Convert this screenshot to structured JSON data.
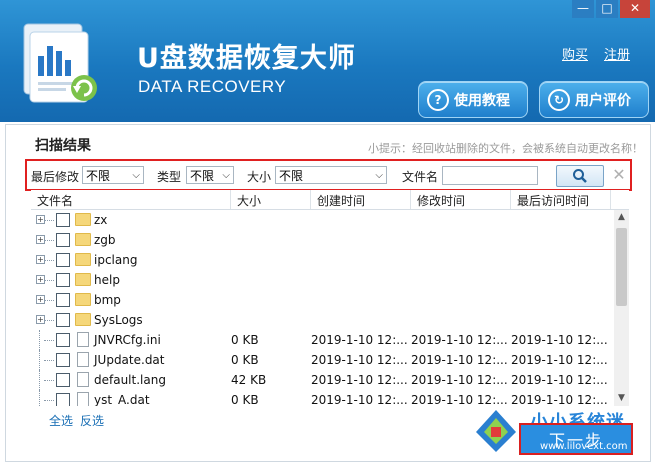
{
  "window": {
    "title": "U盘数据恢复大师",
    "subtitle": "DATA RECOVERY",
    "min": "—",
    "restore": "□",
    "close": "✕"
  },
  "header": {
    "links": {
      "buy": "购买",
      "register": "注册"
    },
    "buttons": {
      "tutorial": "使用教程",
      "review": "用户评价"
    }
  },
  "section": {
    "title": "扫描结果",
    "tip": "小提示：经回收站删除的文件，会被系统自动更改名称！"
  },
  "filters": {
    "modified_label": "最后修改",
    "modified_value": "不限",
    "type_label": "类型",
    "type_value": "不限",
    "size_label": "大小",
    "size_value": "不限",
    "name_label": "文件名",
    "name_value": ""
  },
  "table": {
    "columns": [
      "文件名",
      "大小",
      "创建时间",
      "修改时间",
      "最后访问时间"
    ],
    "rows": [
      {
        "name": "zx",
        "kind": "folder",
        "size": "",
        "created": "",
        "modified": "",
        "accessed": ""
      },
      {
        "name": "zgb",
        "kind": "folder",
        "size": "",
        "created": "",
        "modified": "",
        "accessed": ""
      },
      {
        "name": "ipclang",
        "kind": "folder",
        "size": "",
        "created": "",
        "modified": "",
        "accessed": ""
      },
      {
        "name": "help",
        "kind": "folder",
        "size": "",
        "created": "",
        "modified": "",
        "accessed": ""
      },
      {
        "name": "bmp",
        "kind": "folder",
        "size": "",
        "created": "",
        "modified": "",
        "accessed": ""
      },
      {
        "name": "SysLogs",
        "kind": "folder",
        "size": "",
        "created": "",
        "modified": "",
        "accessed": ""
      },
      {
        "name": "JNVRCfg.ini",
        "kind": "file",
        "size": "0 KB",
        "created": "2019-1-10 12:...",
        "modified": "2019-1-10 12:...",
        "accessed": "2019-1-10 12:..."
      },
      {
        "name": "JUpdate.dat",
        "kind": "file",
        "size": "0 KB",
        "created": "2019-1-10 12:...",
        "modified": "2019-1-10 12:...",
        "accessed": "2019-1-10 12:..."
      },
      {
        "name": "default.lang",
        "kind": "file",
        "size": "42 KB",
        "created": "2019-1-10 12:...",
        "modified": "2019-1-10 12:...",
        "accessed": "2019-1-10 12:..."
      },
      {
        "name": "yst_A.dat",
        "kind": "file",
        "size": "0 KB",
        "created": "2019-1-10 12:...",
        "modified": "2019-1-10 12:...",
        "accessed": "2019-1-10 12:..."
      }
    ]
  },
  "footer": {
    "select_all": "全选",
    "invert": "反选",
    "next": "下一步"
  },
  "watermark": {
    "text": "小小系统迷",
    "url": "www.lilovext.com"
  },
  "colors": {
    "header": "#1a78bf",
    "highlight": "#e02020",
    "link": "#1a6fb5"
  }
}
